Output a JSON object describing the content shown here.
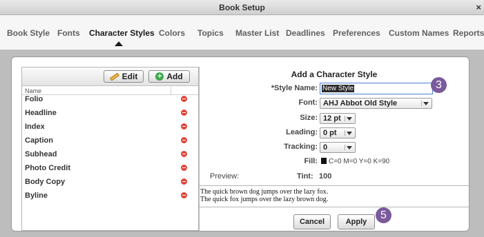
{
  "window": {
    "title": "Book Setup",
    "close_glyph": "×"
  },
  "tabs": [
    {
      "label": "Book Style"
    },
    {
      "label": "Fonts"
    },
    {
      "label": "Character Styles",
      "active": true
    },
    {
      "label": "Colors"
    },
    {
      "label": "Topics"
    },
    {
      "label": "Master List"
    },
    {
      "label": "Deadlines"
    },
    {
      "label": "Preferences"
    },
    {
      "label": "Custom Names"
    },
    {
      "label": "Reports"
    }
  ],
  "list_panel": {
    "edit_label": "Edit",
    "add_label": "Add",
    "column_header": "Name",
    "items": [
      {
        "label": "Folio"
      },
      {
        "label": "Headline"
      },
      {
        "label": "Index"
      },
      {
        "label": "Caption"
      },
      {
        "label": "Subhead"
      },
      {
        "label": "Photo Credit"
      },
      {
        "label": "Body Copy"
      },
      {
        "label": "Byline"
      }
    ]
  },
  "form": {
    "heading": "Add a Character Style",
    "style_name_label": "*Style Name:",
    "style_name_value": "New Style",
    "font_label": "Font:",
    "font_value": "AHJ Abbot Old Style",
    "size_label": "Size:",
    "size_value": "12 pt",
    "leading_label": "Leading:",
    "leading_value": "0 pt",
    "tracking_label": "Tracking:",
    "tracking_value": "0",
    "fill_label": "Fill:",
    "fill_value": "C=0 M=0 Y=0 K=90",
    "fill_color": "#111111",
    "preview_label": "Preview:",
    "tint_label": "Tint:",
    "tint_value": "100",
    "preview_lines": [
      "The quick brown dog jumps over the lazy fox.",
      "The quick fox jumps over the lazy brown dog."
    ],
    "cancel_label": "Cancel",
    "apply_label": "Apply"
  },
  "callouts": {
    "first": "3",
    "second": "5",
    "color": "#7a5a9c"
  }
}
